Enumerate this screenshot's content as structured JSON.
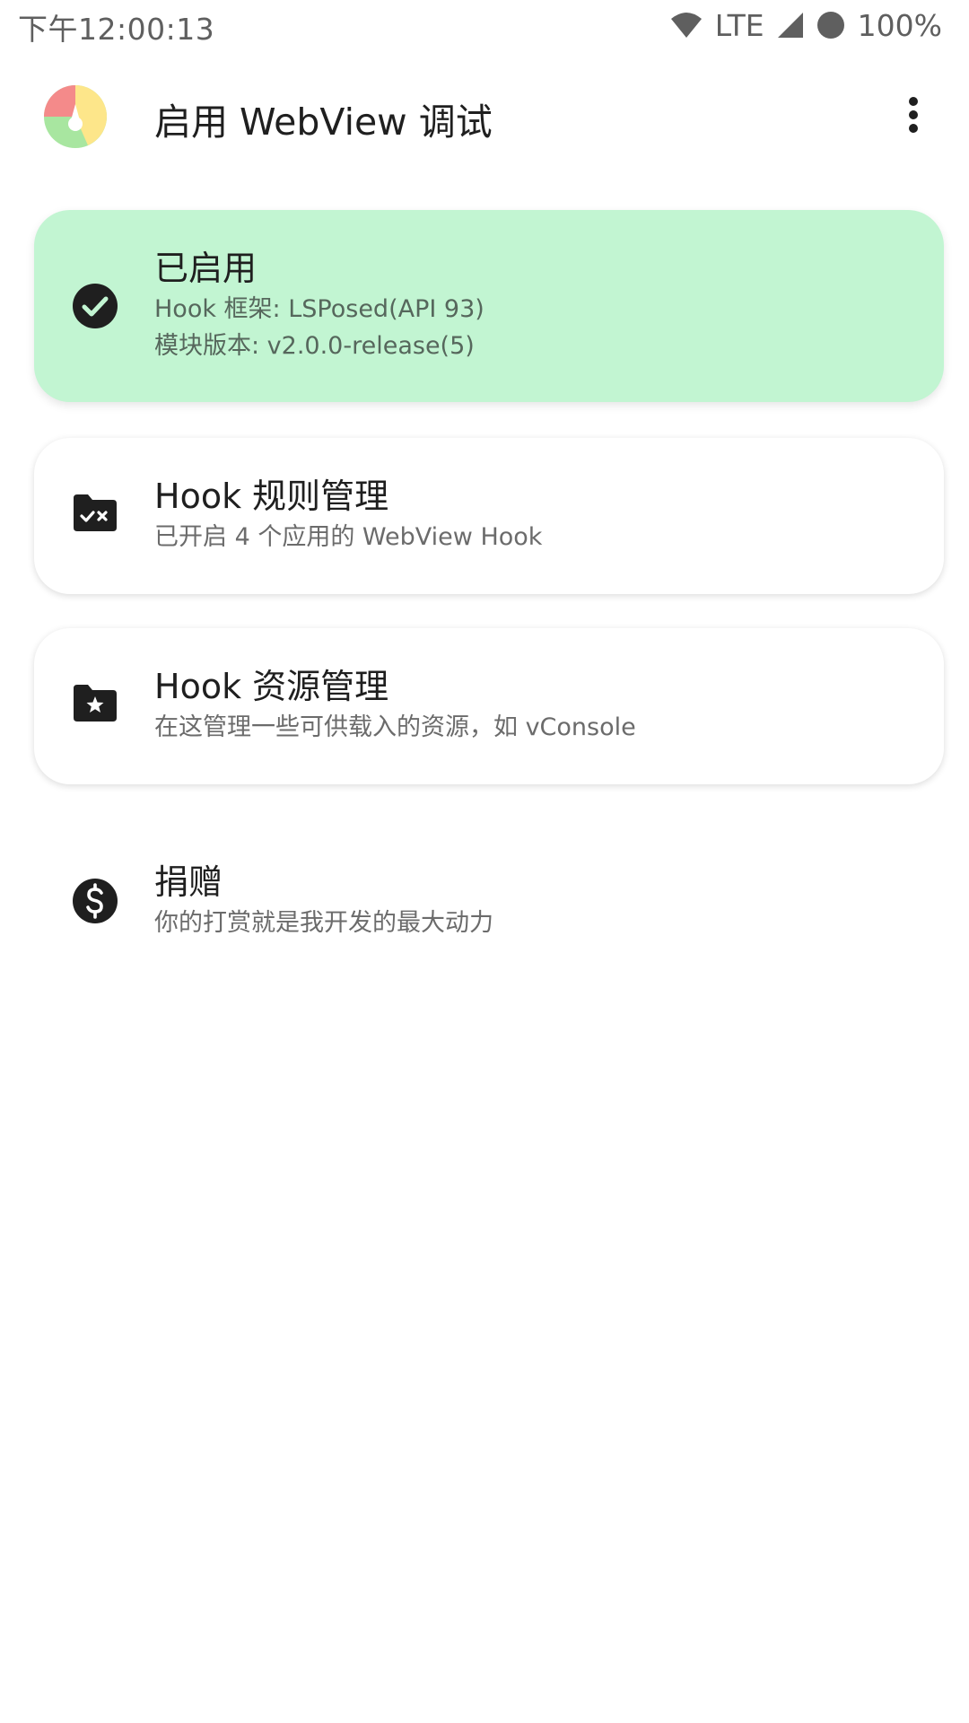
{
  "status_bar": {
    "time": "下午12:00:13",
    "network": "LTE",
    "battery": "100%",
    "icons": [
      "wifi-icon",
      "signal-icon",
      "battery-icon"
    ]
  },
  "app_bar": {
    "title": "启用 WebView 调试",
    "logo": "app-logo-icon",
    "menu_icon": "more-vert-icon"
  },
  "status_card": {
    "title": "已启用",
    "framework": "Hook 框架: LSPosed(API 93)",
    "version": "模块版本: v2.0.0-release(5)",
    "icon": "check-circle-icon",
    "color": "#c2f5d2"
  },
  "rules_card": {
    "title": "Hook 规则管理",
    "subtitle": "已开启 4 个应用的 WebView Hook",
    "icon": "folder-check-x-icon"
  },
  "resources_card": {
    "title": "Hook 资源管理",
    "subtitle": "在这管理一些可供载入的资源，如 vConsole",
    "icon": "folder-star-icon"
  },
  "donate": {
    "title": "捐赠",
    "subtitle": "你的打赏就是我开发的最大动力",
    "icon": "dollar-circle-icon"
  }
}
